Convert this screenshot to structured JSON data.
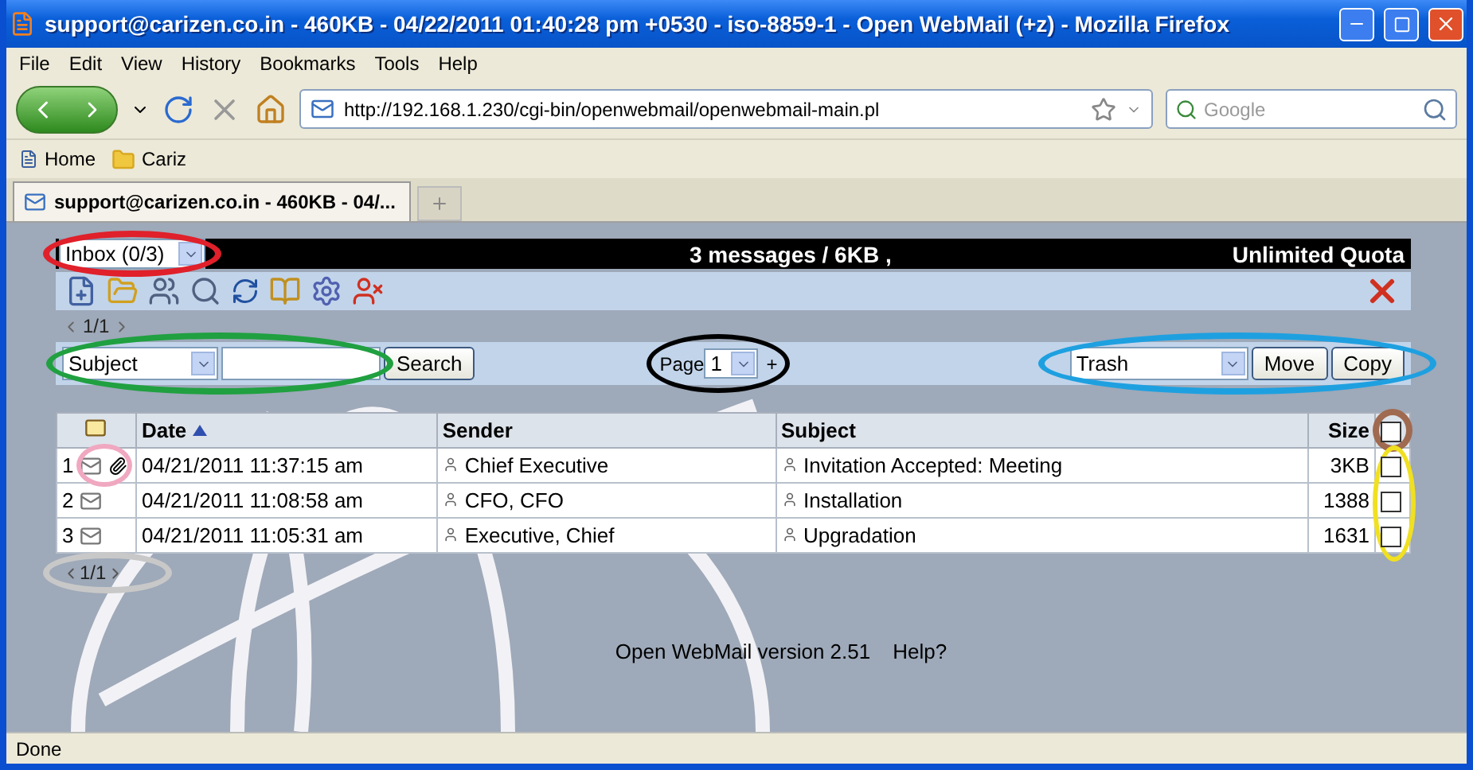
{
  "window": {
    "title": "support@carizen.co.in - 460KB - 04/22/2011 01:40:28 pm +0530 - iso-8859-1 - Open WebMail (+z) - Mozilla Firefox"
  },
  "menu": [
    "File",
    "Edit",
    "View",
    "History",
    "Bookmarks",
    "Tools",
    "Help"
  ],
  "address": {
    "value": "http://192.168.1.230/cgi-bin/openwebmail/openwebmail-main.pl"
  },
  "web_search": {
    "placeholder": "Google"
  },
  "bookmarks": [
    {
      "label": "Home",
      "kind": "page"
    },
    {
      "label": "Cariz",
      "kind": "folder"
    }
  ],
  "tabs": [
    {
      "label": "support@carizen.co.in - 460KB - 04/...",
      "selected": true
    }
  ],
  "header": {
    "folder": "Inbox (0/3)",
    "summary": "3 messages / 6KB ,",
    "quota": "Unlimited Quota"
  },
  "pager_top": "1/1",
  "search": {
    "field": "Subject",
    "button": "Search"
  },
  "page": {
    "label": "Page",
    "value": "1",
    "plus": "+"
  },
  "move": {
    "folder": "Trash",
    "buttons": [
      "Move",
      "Copy"
    ]
  },
  "table": {
    "columns": [
      {
        "label": "Date",
        "sorted": true
      },
      {
        "label": "Sender",
        "sorted": false
      },
      {
        "label": "Subject",
        "sorted": false
      },
      {
        "label": "Size",
        "sorted": false
      }
    ],
    "all_checked": false,
    "rows": [
      {
        "number": "1",
        "attachment": true,
        "date": "04/21/2011 11:37:15 am",
        "sender": "Chief Executive",
        "subject": "Invitation Accepted: Meeting",
        "size": "3KB",
        "checked": false
      },
      {
        "number": "2",
        "attachment": false,
        "date": "04/21/2011 11:08:58 am",
        "sender": "CFO, CFO",
        "subject": "Installation",
        "size": "1388",
        "checked": false
      },
      {
        "number": "3",
        "attachment": false,
        "date": "04/21/2011 11:05:31 am",
        "sender": "Executive, Chief",
        "subject": "Upgradation",
        "size": "1631",
        "checked": false
      }
    ]
  },
  "pager_bottom": "1/1",
  "footer": {
    "version": "Open WebMail version 2.51",
    "help": "Help?"
  },
  "status_bar": "Done",
  "annotations": [
    {
      "kind": "folder",
      "color": "#e0202a"
    },
    {
      "kind": "search",
      "color": "#20a040"
    },
    {
      "kind": "page",
      "color": "#000000"
    },
    {
      "kind": "move",
      "color": "#1ea0e0"
    },
    {
      "kind": "select_all",
      "color": "#a06a50"
    },
    {
      "kind": "checkboxes",
      "color": "#f0e020"
    },
    {
      "kind": "row_icons",
      "color": "#f0a8c0"
    },
    {
      "kind": "pager",
      "color": "#c8c8c8"
    }
  ]
}
